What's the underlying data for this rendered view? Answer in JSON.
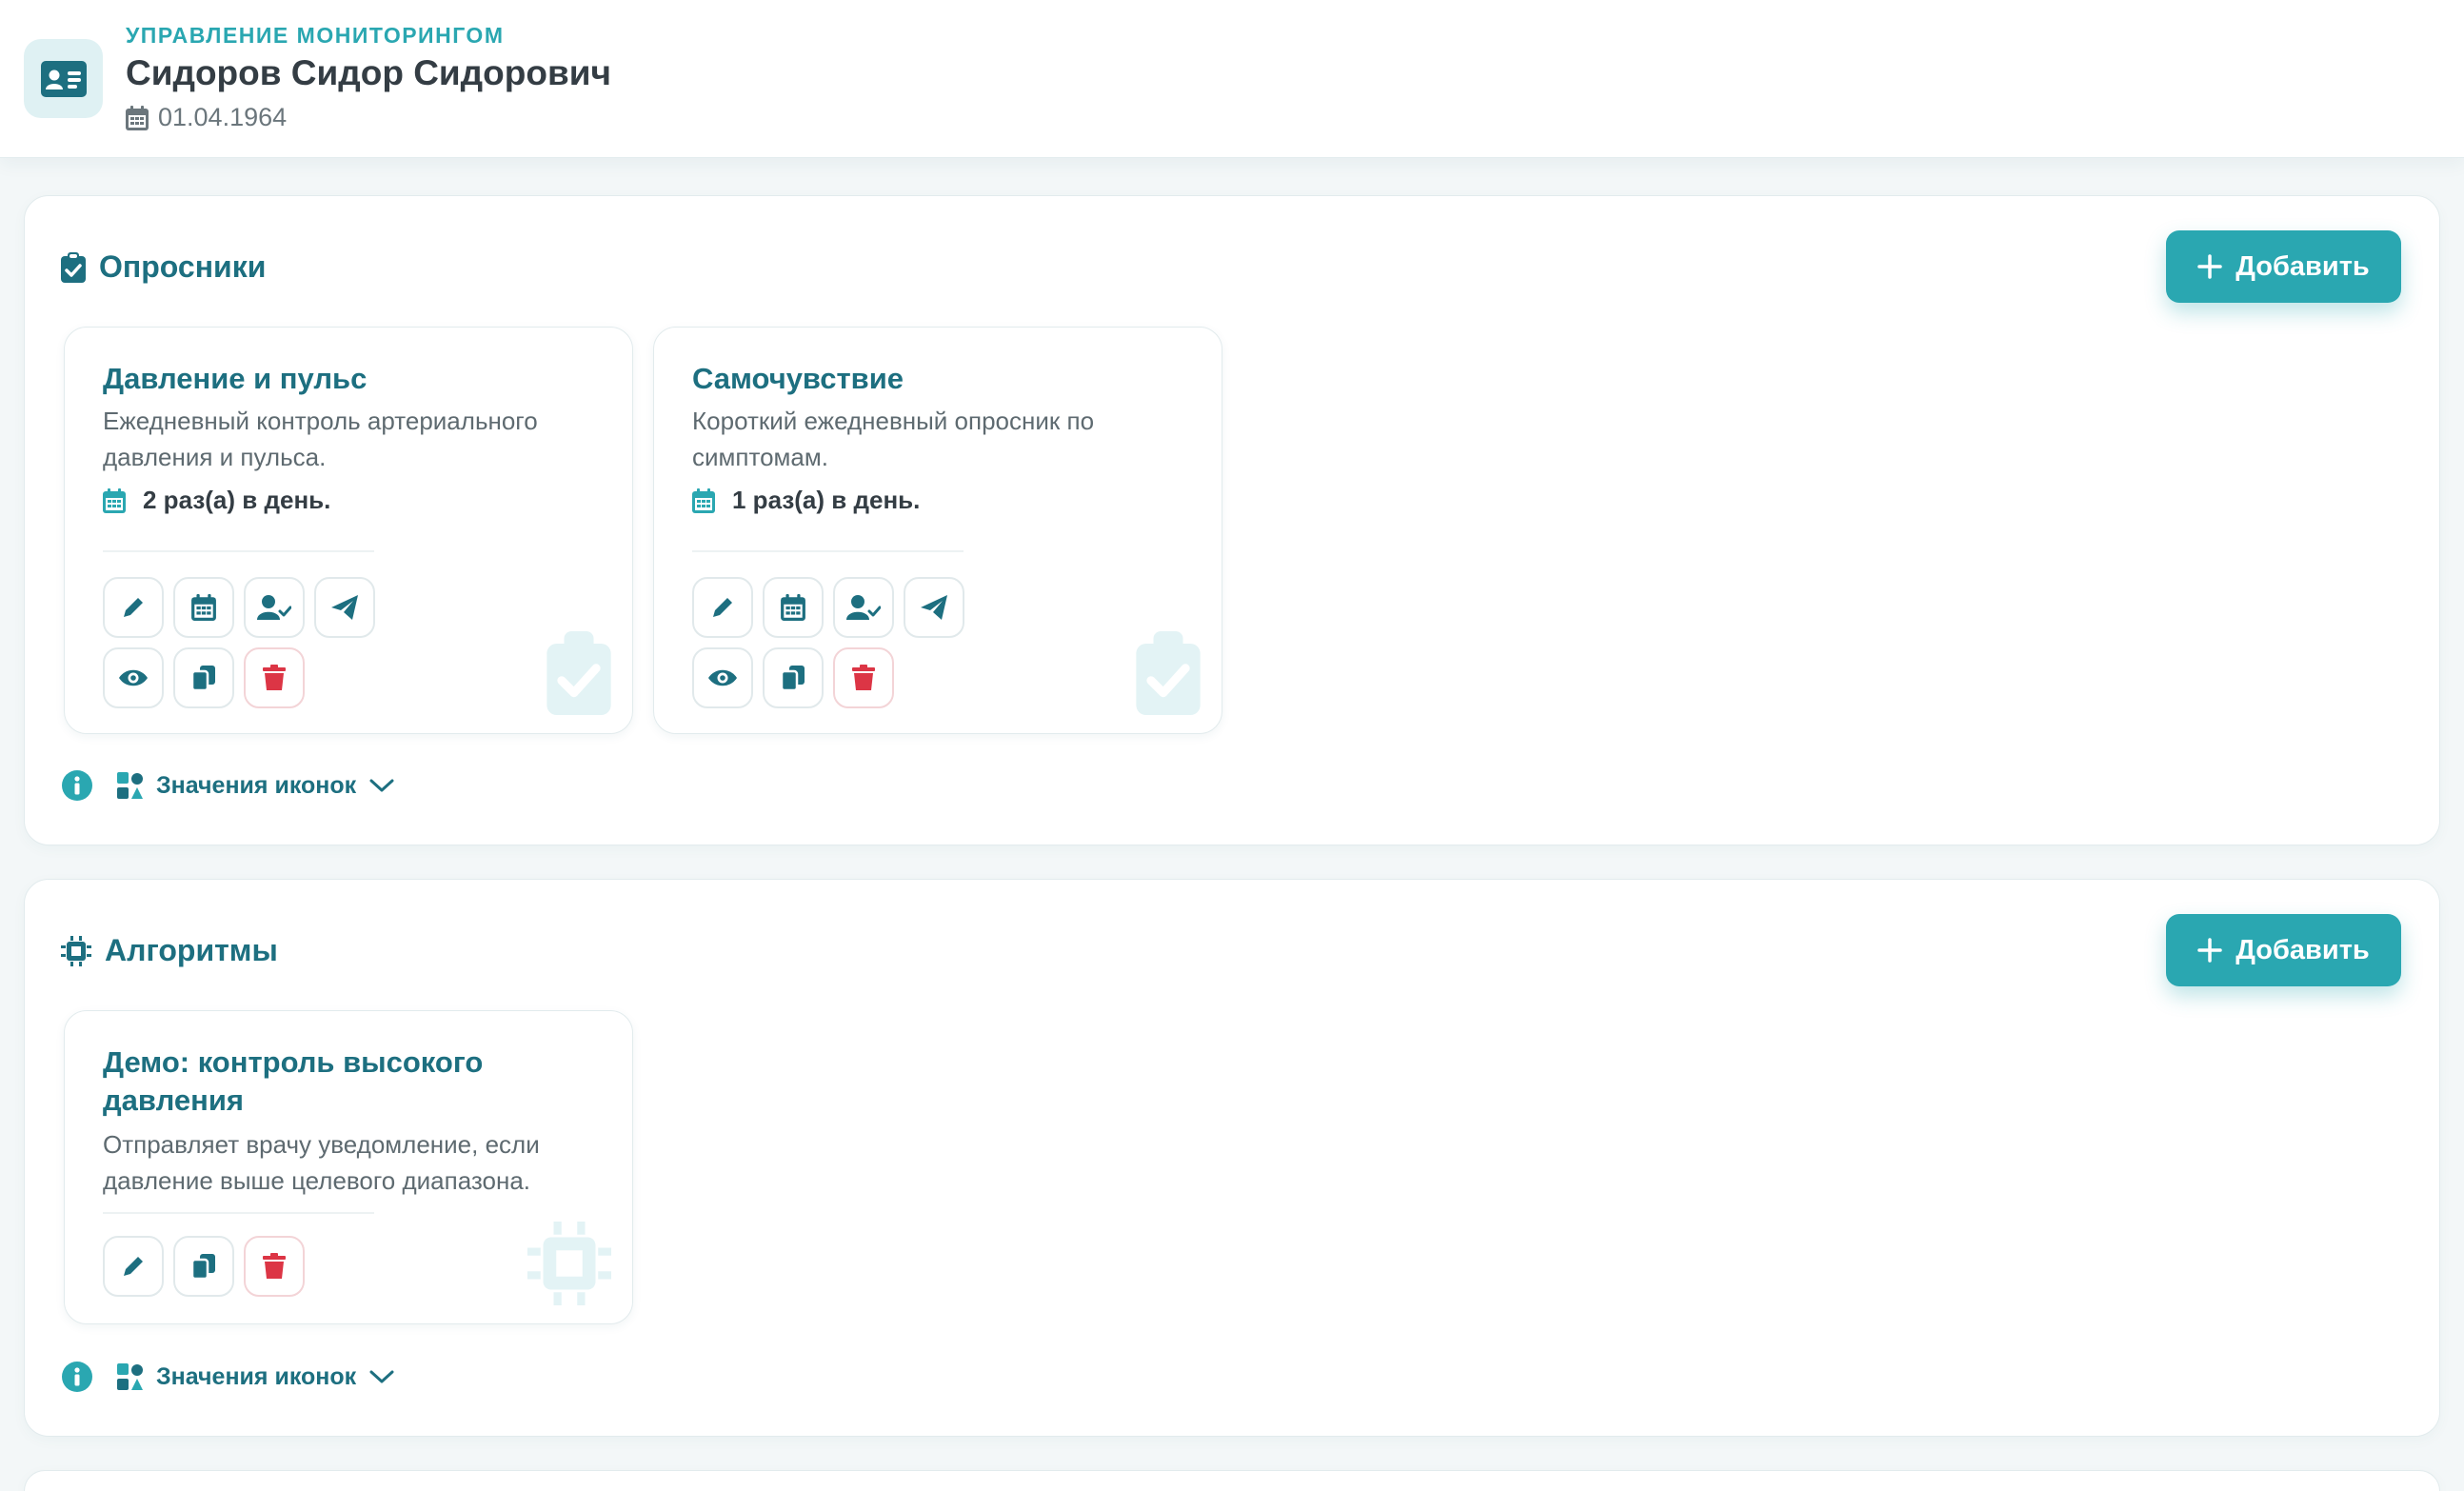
{
  "header": {
    "eyebrow": "Управление мониторингом",
    "patient_name": "Сидоров Сидор Сидорович",
    "birth_date": "01.04.1964",
    "icon": "id-card-icon"
  },
  "colors": {
    "accent": "#2aa7b1",
    "heading": "#1d6f80",
    "danger": "#dc3545",
    "text": "#343d44",
    "muted": "#5e6a70"
  },
  "questionnaires": {
    "title": "Опросники",
    "add_label": "Добавить",
    "legend_label": "Значения иконок",
    "cards": [
      {
        "title": "Давление и пульс",
        "desc_line1": "Ежедневный контроль артериального",
        "desc_line2": "давления и пульса.",
        "frequency": "2 раз(а) в день."
      },
      {
        "title": "Самочувствие",
        "desc_line1": "Короткий ежедневный опросник по",
        "desc_line2": "симптомам.",
        "frequency": "1 раз(а) в день."
      }
    ]
  },
  "algorithms": {
    "title": "Алгоритмы",
    "add_label": "Добавить",
    "legend_label": "Значения иконок",
    "cards": [
      {
        "title_line1": "Демо: контроль высокого",
        "title_line2": "давления",
        "desc_line1": "Отправляет врачу уведомление, если",
        "desc_line2": "давление выше целевого диапазона."
      }
    ]
  }
}
